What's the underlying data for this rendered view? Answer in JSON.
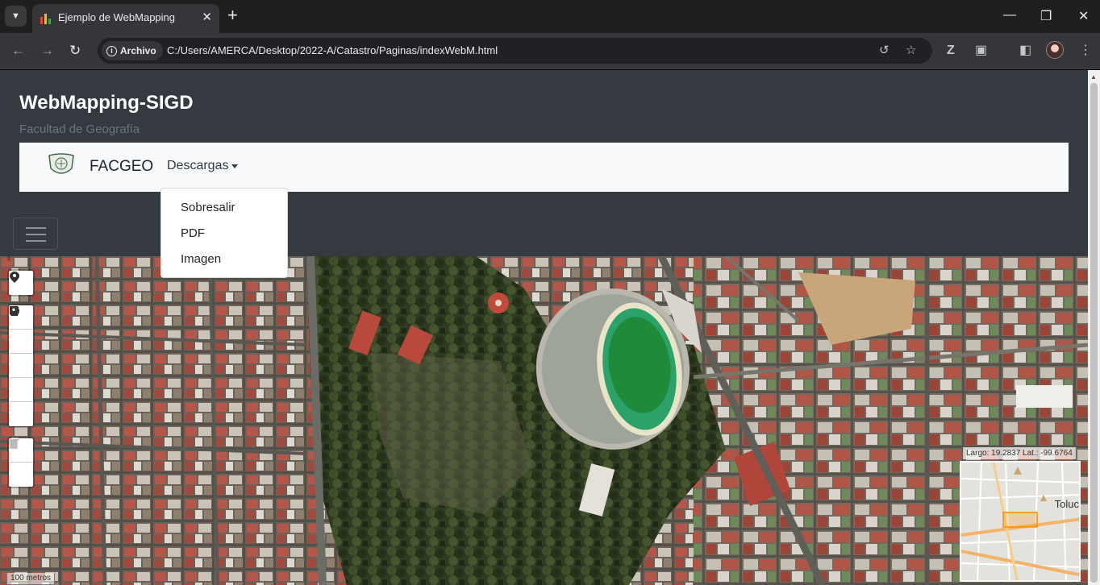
{
  "browser": {
    "tab_title": "Ejemplo de WebMapping",
    "new_tab_symbol": "+",
    "security_chip": "Archivo",
    "url": "C:/Users/AMERCA/Desktop/2022-A/Catastro/Paginas/indexWebM.html"
  },
  "site": {
    "title": "WebMapping-SIGD",
    "subtitle": "Facultad de Geografía"
  },
  "navbar": {
    "brand": "FACGEO",
    "dropdown_label": "Descargas",
    "dropdown_items": [
      "Sobresalir",
      "PDF",
      "Imagen"
    ]
  },
  "map": {
    "scale_label": "100 metros",
    "coords_label": "Largo: 19.2837 Lat.: -99.6764",
    "minimap_label": "Toluc",
    "draw_tools": [
      "marker-icon",
      "polyline-icon",
      "polygon-icon",
      "rectangle-icon",
      "circle-icon",
      "circle-marker-icon",
      "edit-icon",
      "delete-icon"
    ]
  },
  "colors": {
    "page_bg": "#343a40",
    "navbar_bg": "#f8f9fa",
    "subtitle": "#6c757d",
    "stadium_field": "#1f8a3a"
  }
}
